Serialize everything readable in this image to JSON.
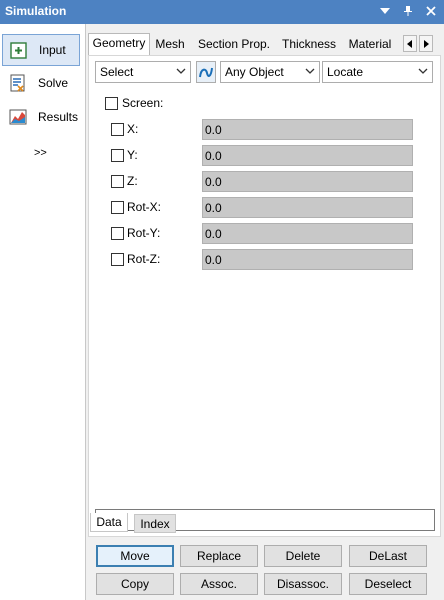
{
  "window": {
    "title": "Simulation",
    "icons": [
      "dropdown-arrow-icon",
      "pin-icon",
      "close-icon"
    ]
  },
  "sidebar": {
    "items": [
      {
        "label": "Input",
        "icon": "input-icon",
        "active": true
      },
      {
        "label": "Solve",
        "icon": "solve-icon",
        "active": false
      },
      {
        "label": "Results",
        "icon": "results-icon",
        "active": false
      }
    ],
    "more_label": ">>"
  },
  "tabs": [
    {
      "label": "Geometry",
      "active": true
    },
    {
      "label": "Mesh",
      "active": false
    },
    {
      "label": "Section Prop.",
      "active": false
    },
    {
      "label": "Thickness",
      "active": false
    },
    {
      "label": "Material",
      "active": false
    }
  ],
  "toolbar": {
    "select_value": "Select",
    "object_filter_value": "Any Object",
    "locate_value": "Locate"
  },
  "screen_checkbox_label": "Screen:",
  "coordinate_fields": [
    {
      "label": "X:",
      "value": "0.0"
    },
    {
      "label": "Y:",
      "value": "0.0"
    },
    {
      "label": "Z:",
      "value": "0.0"
    },
    {
      "label": "Rot-X:",
      "value": "0.0"
    },
    {
      "label": "Rot-Y:",
      "value": "0.0"
    },
    {
      "label": "Rot-Z:",
      "value": "0.0"
    }
  ],
  "bottom_tabs": [
    {
      "label": "Data",
      "active": true
    },
    {
      "label": "Index",
      "active": false
    }
  ],
  "buttons": {
    "row1": [
      "Move",
      "Replace",
      "Delete",
      "DeLast"
    ],
    "row2": [
      "Copy",
      "Assoc.",
      "Disassoc.",
      "Deselect"
    ]
  },
  "colors": {
    "title_bar": "#4d82c2",
    "active_side": "#dde8f6",
    "field_bg": "#c8c8c8",
    "default_button_border": "#3c7fb1"
  }
}
